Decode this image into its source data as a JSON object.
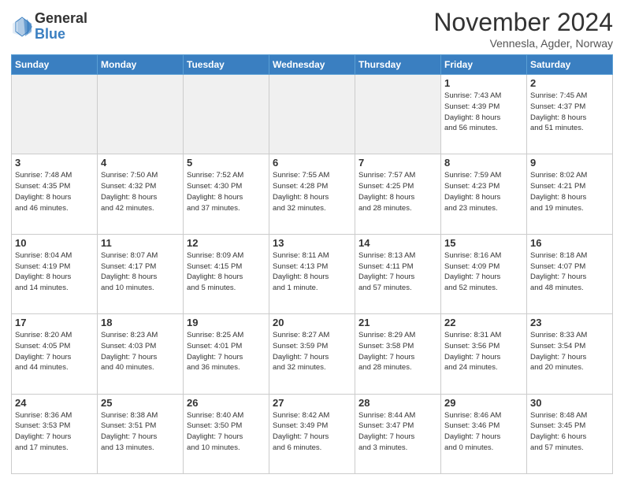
{
  "logo": {
    "general": "General",
    "blue": "Blue"
  },
  "title": "November 2024",
  "location": "Vennesla, Agder, Norway",
  "days_header": [
    "Sunday",
    "Monday",
    "Tuesday",
    "Wednesday",
    "Thursday",
    "Friday",
    "Saturday"
  ],
  "weeks": [
    [
      {
        "day": "",
        "info": ""
      },
      {
        "day": "",
        "info": ""
      },
      {
        "day": "",
        "info": ""
      },
      {
        "day": "",
        "info": ""
      },
      {
        "day": "",
        "info": ""
      },
      {
        "day": "1",
        "info": "Sunrise: 7:43 AM\nSunset: 4:39 PM\nDaylight: 8 hours\nand 56 minutes."
      },
      {
        "day": "2",
        "info": "Sunrise: 7:45 AM\nSunset: 4:37 PM\nDaylight: 8 hours\nand 51 minutes."
      }
    ],
    [
      {
        "day": "3",
        "info": "Sunrise: 7:48 AM\nSunset: 4:35 PM\nDaylight: 8 hours\nand 46 minutes."
      },
      {
        "day": "4",
        "info": "Sunrise: 7:50 AM\nSunset: 4:32 PM\nDaylight: 8 hours\nand 42 minutes."
      },
      {
        "day": "5",
        "info": "Sunrise: 7:52 AM\nSunset: 4:30 PM\nDaylight: 8 hours\nand 37 minutes."
      },
      {
        "day": "6",
        "info": "Sunrise: 7:55 AM\nSunset: 4:28 PM\nDaylight: 8 hours\nand 32 minutes."
      },
      {
        "day": "7",
        "info": "Sunrise: 7:57 AM\nSunset: 4:25 PM\nDaylight: 8 hours\nand 28 minutes."
      },
      {
        "day": "8",
        "info": "Sunrise: 7:59 AM\nSunset: 4:23 PM\nDaylight: 8 hours\nand 23 minutes."
      },
      {
        "day": "9",
        "info": "Sunrise: 8:02 AM\nSunset: 4:21 PM\nDaylight: 8 hours\nand 19 minutes."
      }
    ],
    [
      {
        "day": "10",
        "info": "Sunrise: 8:04 AM\nSunset: 4:19 PM\nDaylight: 8 hours\nand 14 minutes."
      },
      {
        "day": "11",
        "info": "Sunrise: 8:07 AM\nSunset: 4:17 PM\nDaylight: 8 hours\nand 10 minutes."
      },
      {
        "day": "12",
        "info": "Sunrise: 8:09 AM\nSunset: 4:15 PM\nDaylight: 8 hours\nand 5 minutes."
      },
      {
        "day": "13",
        "info": "Sunrise: 8:11 AM\nSunset: 4:13 PM\nDaylight: 8 hours\nand 1 minute."
      },
      {
        "day": "14",
        "info": "Sunrise: 8:13 AM\nSunset: 4:11 PM\nDaylight: 7 hours\nand 57 minutes."
      },
      {
        "day": "15",
        "info": "Sunrise: 8:16 AM\nSunset: 4:09 PM\nDaylight: 7 hours\nand 52 minutes."
      },
      {
        "day": "16",
        "info": "Sunrise: 8:18 AM\nSunset: 4:07 PM\nDaylight: 7 hours\nand 48 minutes."
      }
    ],
    [
      {
        "day": "17",
        "info": "Sunrise: 8:20 AM\nSunset: 4:05 PM\nDaylight: 7 hours\nand 44 minutes."
      },
      {
        "day": "18",
        "info": "Sunrise: 8:23 AM\nSunset: 4:03 PM\nDaylight: 7 hours\nand 40 minutes."
      },
      {
        "day": "19",
        "info": "Sunrise: 8:25 AM\nSunset: 4:01 PM\nDaylight: 7 hours\nand 36 minutes."
      },
      {
        "day": "20",
        "info": "Sunrise: 8:27 AM\nSunset: 3:59 PM\nDaylight: 7 hours\nand 32 minutes."
      },
      {
        "day": "21",
        "info": "Sunrise: 8:29 AM\nSunset: 3:58 PM\nDaylight: 7 hours\nand 28 minutes."
      },
      {
        "day": "22",
        "info": "Sunrise: 8:31 AM\nSunset: 3:56 PM\nDaylight: 7 hours\nand 24 minutes."
      },
      {
        "day": "23",
        "info": "Sunrise: 8:33 AM\nSunset: 3:54 PM\nDaylight: 7 hours\nand 20 minutes."
      }
    ],
    [
      {
        "day": "24",
        "info": "Sunrise: 8:36 AM\nSunset: 3:53 PM\nDaylight: 7 hours\nand 17 minutes."
      },
      {
        "day": "25",
        "info": "Sunrise: 8:38 AM\nSunset: 3:51 PM\nDaylight: 7 hours\nand 13 minutes."
      },
      {
        "day": "26",
        "info": "Sunrise: 8:40 AM\nSunset: 3:50 PM\nDaylight: 7 hours\nand 10 minutes."
      },
      {
        "day": "27",
        "info": "Sunrise: 8:42 AM\nSunset: 3:49 PM\nDaylight: 7 hours\nand 6 minutes."
      },
      {
        "day": "28",
        "info": "Sunrise: 8:44 AM\nSunset: 3:47 PM\nDaylight: 7 hours\nand 3 minutes."
      },
      {
        "day": "29",
        "info": "Sunrise: 8:46 AM\nSunset: 3:46 PM\nDaylight: 7 hours\nand 0 minutes."
      },
      {
        "day": "30",
        "info": "Sunrise: 8:48 AM\nSunset: 3:45 PM\nDaylight: 6 hours\nand 57 minutes."
      }
    ]
  ]
}
